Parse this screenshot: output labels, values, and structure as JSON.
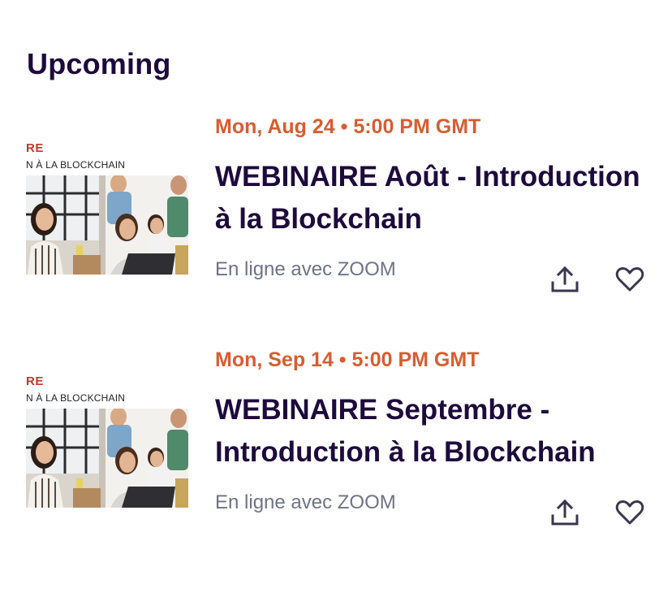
{
  "section": {
    "title": "Upcoming"
  },
  "events": [
    {
      "date": "Mon, Aug 24 • 5:00 PM GMT",
      "title": "WEBINAIRE Août - Introduction à la Blockchain",
      "location": "En ligne avec ZOOM",
      "thumbnail": {
        "heading_fragment": "RE",
        "subheading_fragment": "N À LA BLOCKCHAIN"
      },
      "actions": {
        "share_icon": "share-upload-icon",
        "like_icon": "heart-icon"
      }
    },
    {
      "date": "Mon, Sep 14 • 5:00 PM GMT",
      "title": "WEBINAIRE Septembre - Introduction à la Blockchain",
      "location": "En ligne avec ZOOM",
      "thumbnail": {
        "heading_fragment": "RE",
        "subheading_fragment": "N À LA BLOCKCHAIN"
      },
      "actions": {
        "share_icon": "share-upload-icon",
        "like_icon": "heart-icon"
      }
    }
  ],
  "colors": {
    "title": "#1e0a3c",
    "date": "#d1410c",
    "location": "#6f7287",
    "icon": "#39364f",
    "thumb_heading": "#c0392b"
  }
}
